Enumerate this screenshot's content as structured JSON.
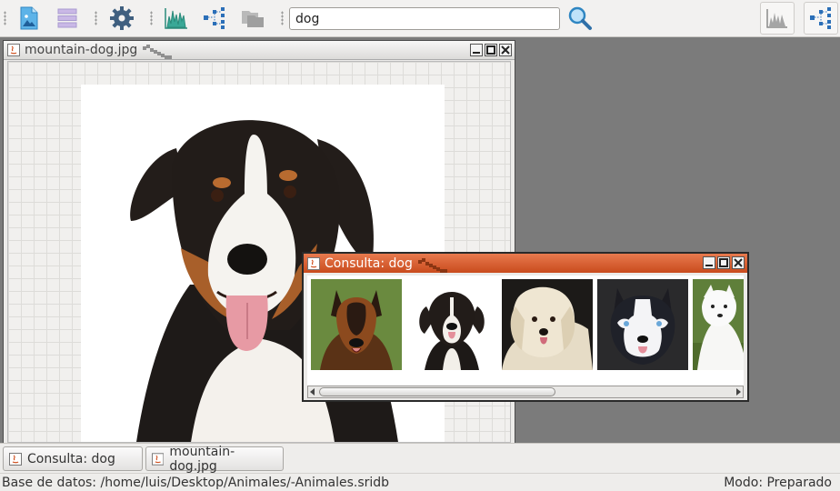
{
  "toolbar": {
    "search_value": "dog",
    "buttons": [
      "open-image-icon",
      "database-list-icon",
      "settings-gear-icon",
      "histogram-icon",
      "tree-graph-icon",
      "folders-icon",
      "search-icon",
      "histogram-view-icon",
      "tree-view-icon"
    ]
  },
  "image_window": {
    "title": "mountain-dog.jpg"
  },
  "query_window": {
    "title": "Consulta: dog",
    "results": [
      "german-shepherd",
      "bernese-puppy",
      "white-fluffy-dog",
      "husky",
      "white-spitz"
    ]
  },
  "taskbar": {
    "items": [
      "Consulta: dog",
      "mountain-dog.jpg"
    ]
  },
  "status": {
    "database": "Base de datos: /home/luis/Desktop/Animales/-Animales.sridb",
    "mode": "Modo: Preparado"
  },
  "colors": {
    "accent_title": "#d9602f",
    "desktop": "#7b7b7b"
  }
}
